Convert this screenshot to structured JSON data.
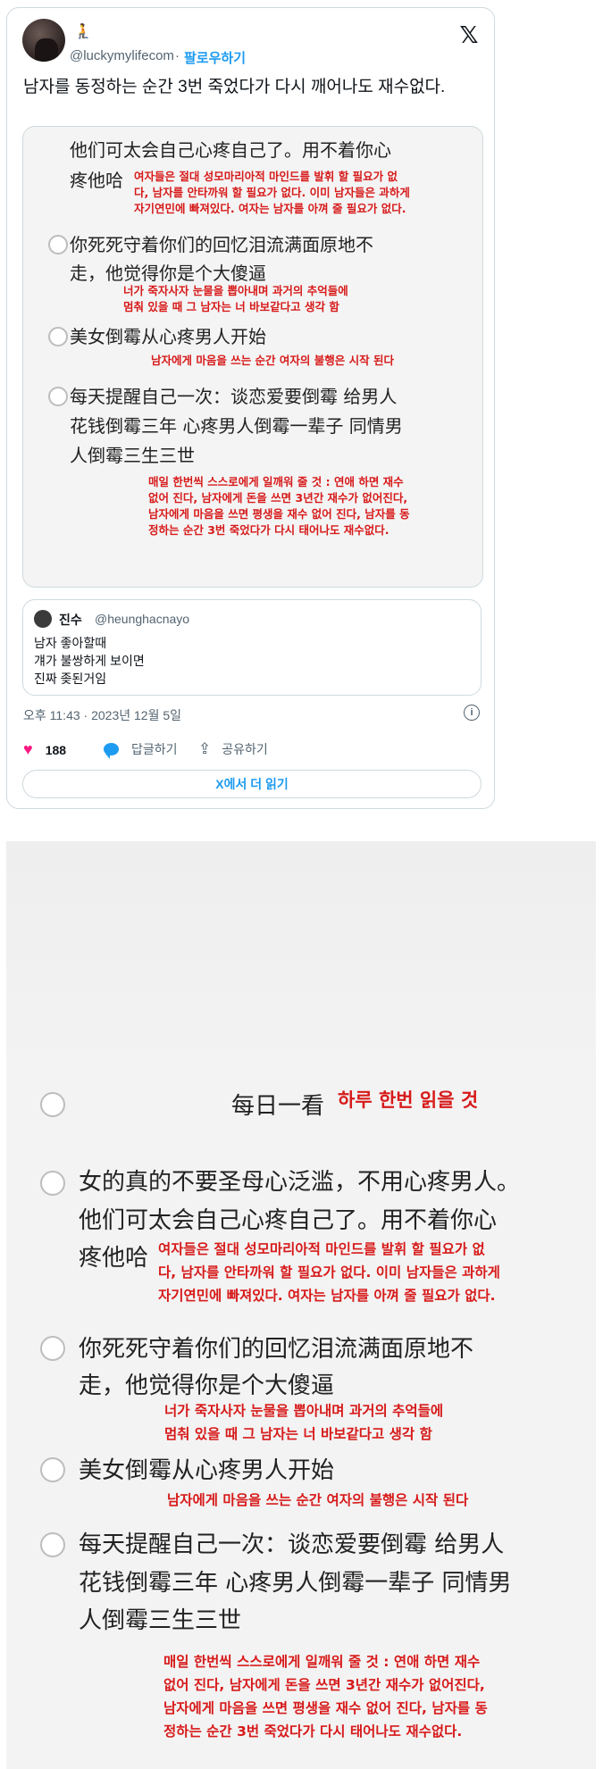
{
  "tweet": {
    "badge": "🧎",
    "handle": "@luckymylifecom",
    "separator": "·",
    "follow_label": "팔로우하기",
    "x_logo": "𝕏",
    "text": "남자를 동정하는 순간 3번 죽었다가 다시 깨어나도 재수없다.",
    "timestamp": "오후 11:43 · 2023년 12월 5일",
    "info_icon": "i",
    "likes": "188",
    "reply_label": "답글하기",
    "share_label": "공유하기",
    "read_more": "X에서 더 읽기"
  },
  "quote": {
    "name": "진수",
    "handle": "@heunghacnayo",
    "lines": [
      "남자 좋아할때",
      "걔가 불쌍하게 보이면",
      "진짜 좆된거임"
    ]
  },
  "image": {
    "daily_cn": "每日一看",
    "daily_kr": "하루 한번 읽을 것",
    "items": [
      {
        "cn": [
          "女的真的不要圣母心泛滥，不用心疼男人。",
          "他们可太会自己心疼自己了。用不着你心",
          "疼他哈"
        ],
        "kr": [
          "여자들은 절대 성모마리아적 마인드를 발휘 할 필요가 없",
          "다, 남자를 안타까워 할 필요가 없다. 이미 남자들은 과하게",
          "자기연민에 빠져있다. 여자는 남자를 아껴 줄 필요가 없다."
        ]
      },
      {
        "cn": [
          "你死死守着你们的回忆泪流满面原地不",
          "走，他觉得你是个大傻逼"
        ],
        "kr": [
          "너가 죽자사자 눈물을 뽑아내며 과거의 추억들에",
          "멈춰 있을 때 그 남자는 너 바보같다고 생각 함"
        ]
      },
      {
        "cn": [
          "美女倒霉从心疼男人开始"
        ],
        "kr": [
          "남자에게 마음을 쓰는 순간 여자의 불행은 시작 된다"
        ]
      },
      {
        "cn": [
          "每天提醒自己一次：谈恋爱要倒霉 给男人",
          "花钱倒霉三年 心疼男人倒霉一辈子 同情男",
          "人倒霉三生三世"
        ],
        "kr": [
          "매일 한번씩 스스로에게 일깨워 줄 것 : 연애 하면 재수",
          "없어 진다, 남자에게 돈을 쓰면 3년간 재수가 없어진다,",
          "남자에게 마음을 쓰면 평생을 재수 없어 진다, 남자를 동",
          "정하는 순간 3번 죽었다가 다시 태어나도 재수없다."
        ]
      }
    ]
  }
}
